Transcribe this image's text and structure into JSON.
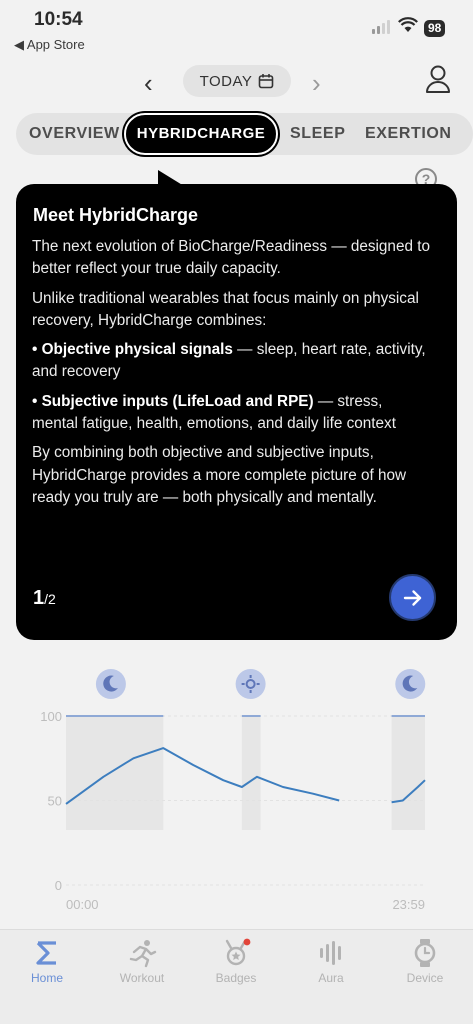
{
  "status": {
    "time": "10:54",
    "back_label": "◀ App Store",
    "battery": "98"
  },
  "header": {
    "prev_label": "‹",
    "next_label": "›",
    "date_label": "TODAY"
  },
  "tabs": [
    {
      "label": "OVERVIEW",
      "active": false
    },
    {
      "label": "HYBRIDCHARGE",
      "active": true
    },
    {
      "label": "SLEEP",
      "active": false
    },
    {
      "label": "EXERTION",
      "active": false
    }
  ],
  "tooltip": {
    "title": "Meet HybridCharge",
    "para1": "The next evolution of BioCharge/Readiness — designed to better reflect your true daily capacity.",
    "para2": "Unlike traditional wearables that focus mainly on physical recovery, HybridCharge combines:",
    "bullet1_bold": "• Objective physical signals",
    "bullet1_rest": " — sleep, heart rate, activity, and recovery",
    "bullet2_bold": "• Subjective inputs (LifeLoad and RPE)",
    "bullet2_rest": " — stress, mental fatigue, health, emotions, and daily life context",
    "para3": "By combining both objective and subjective inputs, HybridCharge provides a more complete picture of how ready you truly are — both physically and mentally.",
    "page_current": "1",
    "page_total": "/2"
  },
  "chart_data": {
    "type": "line",
    "x_labels": [
      "00:00",
      "23:59"
    ],
    "ylim": [
      0,
      100
    ],
    "y_ticks": [
      "100",
      "50",
      "0"
    ],
    "series": [
      {
        "values": [
          {
            "x": "00:00",
            "y": 48
          },
          {
            "x": "02:30",
            "y": 64
          },
          {
            "x": "04:30",
            "y": 75
          },
          {
            "x": "06:30",
            "y": 81
          },
          {
            "x": "08:30",
            "y": 71
          },
          {
            "x": "10:30",
            "y": 62
          },
          {
            "x": "11:45",
            "y": 58
          },
          {
            "x": "12:45",
            "y": 64
          },
          {
            "x": "14:30",
            "y": 58
          },
          {
            "x": "16:30",
            "y": 54
          },
          {
            "x": "18:15",
            "y": 50
          }
        ]
      },
      {
        "values": [
          {
            "x": "21:45",
            "y": 49
          },
          {
            "x": "22:30",
            "y": 50
          },
          {
            "x": "23:30",
            "y": 58
          },
          {
            "x": "23:59",
            "y": 62
          }
        ]
      }
    ],
    "markers": [
      "sleep-icon",
      "sun-icon",
      "sleep-icon"
    ],
    "grid": true
  },
  "bottom_nav": [
    {
      "label": "Home",
      "icon": "sigma-icon",
      "active": true
    },
    {
      "label": "Workout",
      "icon": "runner-icon",
      "active": false
    },
    {
      "label": "Badges",
      "icon": "badge-icon",
      "active": false
    },
    {
      "label": "Aura",
      "icon": "aura-icon",
      "active": false
    },
    {
      "label": "Device",
      "icon": "watch-icon",
      "active": false
    }
  ],
  "colors": {
    "accent": "#3e63d4",
    "line": "#3d7ebf",
    "nav_active": "#6a8fd6"
  }
}
